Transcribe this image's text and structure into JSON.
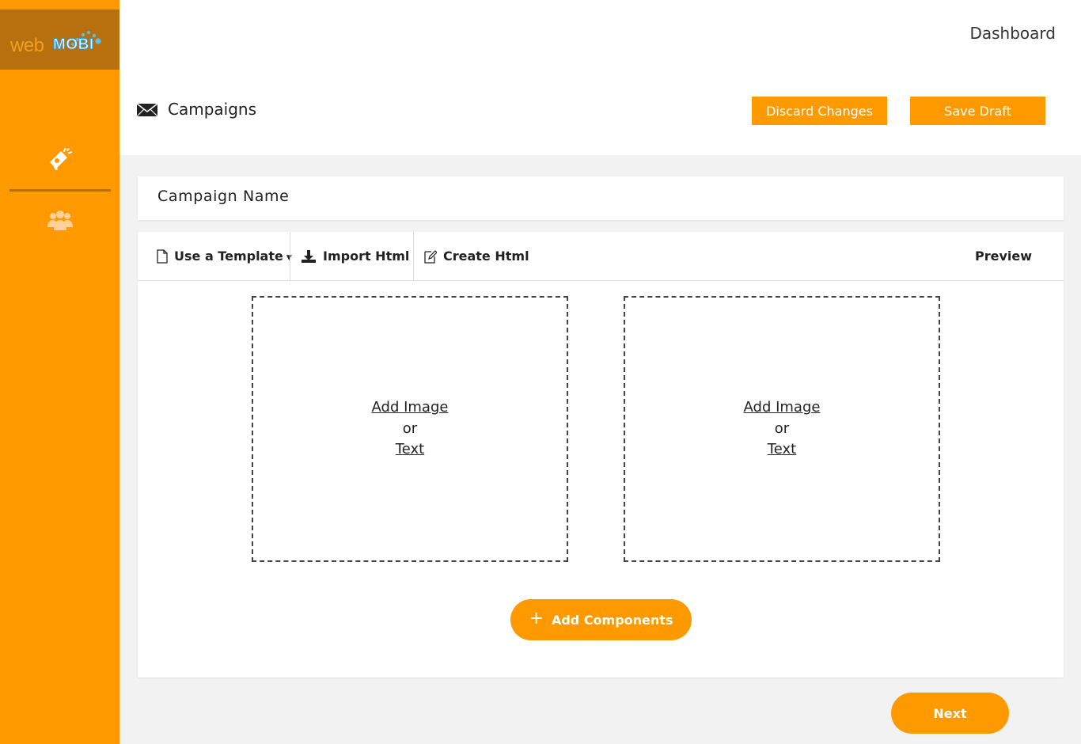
{
  "brand": {
    "logo_part1": "web",
    "logo_part2": "MOBI"
  },
  "sidebar": {
    "items": [
      {
        "icon": "megaphone-icon"
      },
      {
        "icon": "users-icon"
      }
    ]
  },
  "header": {
    "dashboard_link": "Dashboard",
    "page_title": "Campaigns",
    "page_icon": "envelope-icon",
    "discard_label": "Discard Changes",
    "save_label": "Save Draft"
  },
  "campaign_name": {
    "label": "Campaign Name"
  },
  "toolbar": {
    "use_template": "Use a Template",
    "import_html": "Import Html",
    "create_html": "Create Html",
    "preview": "Preview"
  },
  "dropzones": [
    {
      "add_image": "Add Image",
      "or": "or",
      "text": "Text"
    },
    {
      "add_image": "Add Image",
      "or": "or",
      "text": "Text"
    }
  ],
  "add_components": {
    "plus": "+",
    "label": "Add Components"
  },
  "next_label": "Next",
  "colors": {
    "accent": "#fe9900",
    "logo_bg": "#b86f0d",
    "background": "#f2f2f2"
  }
}
